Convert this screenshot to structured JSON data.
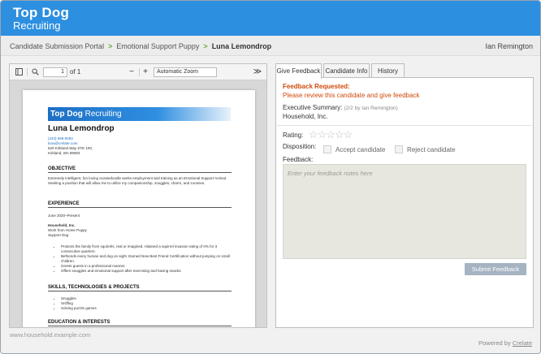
{
  "brand": {
    "title": "Top Dog",
    "subtitle": "Recruiting"
  },
  "breadcrumb": {
    "items": [
      "Candidate Submission Portal",
      "Emotional Support Puppy",
      "Luna Lemondrop"
    ],
    "separator": ">"
  },
  "user": {
    "name": "Ian Remington"
  },
  "viewer": {
    "page_current": "1",
    "page_total_label": "of 1",
    "zoom": "Automatic Zoom",
    "icons": [
      "sidebar-toggle-icon",
      "search-icon",
      "zoom-out-icon",
      "zoom-in-icon",
      "more-tools-icon"
    ],
    "zoom_out": "−",
    "zoom_in": "+",
    "more": "≫"
  },
  "resume": {
    "banner_bold": "Top Dog",
    "banner_light": "Recruiting",
    "name": "Luna Lemondrop",
    "phone": "(443) 568-9283",
    "email": "luna@crelate.com",
    "address1": "620 Kirkland Way STE 100,",
    "address2": "Kirkland, WA 98083",
    "objective_heading": "OBJECTIVE",
    "objective_text": "Extremely intelligent, fun loving Aussiedoodle seeks employment and training as an Emotional Support Animal. Seeking a position that will allow me to utilize my companionship, snuggles, charm, and zoomies.",
    "experience_heading": "EXPERIENCE",
    "exp_dates": "June 2020–Present",
    "exp_company": "Household, Inc.",
    "exp_location": "Work from Home Puppy",
    "exp_title": "Support Dog",
    "exp_bullets": [
      "Protects the family from squirrels, real or imagined. Attained a squirrel invasion rating of 0% for 3 consecutive quarters.",
      "Befriends every human and dog on sight. Earned New Best Friend Certification without jumping on small children.",
      "Greets guests in a professional manner.",
      "Offers snuggles and emotional support after exercising and having snacks."
    ],
    "skills_heading": "SKILLS, TECHNOLOGIES & PROJECTS",
    "skills": [
      "Snuggles",
      "Sniffing",
      "Solving puzzle games"
    ],
    "education_heading": "EDUCATION & INTERESTS"
  },
  "tabs": [
    {
      "label": "Give Feedback",
      "active": true
    },
    {
      "label": "Candidate Info",
      "active": false
    },
    {
      "label": "History",
      "active": false
    }
  ],
  "feedback": {
    "requested_title": "Feedback Requested:",
    "requested_msg": "Please review this candidate and give feedback",
    "exec_label": "Executive Summary:",
    "exec_meta": "(2/2 by Ian Remington)",
    "exec_value": "Household, Inc.",
    "rating_label": "Rating:",
    "rating_value": 0,
    "rating_max": 5,
    "stars": "☆☆☆☆☆",
    "disposition_label": "Disposition:",
    "accept_label": "Accept candidate",
    "reject_label": "Reject candidate",
    "feedback_label": "Feedback:",
    "feedback_placeholder": "Enter your feedback notes here",
    "feedback_value": "",
    "submit_label": "Submit Feedback"
  },
  "footer": {
    "url": "www.household.example.com",
    "powered_prefix": "Powered by",
    "powered_link": "Crelate"
  },
  "colors": {
    "brand_blue": "#2d8fe0",
    "breadcrumb_separator": "#6aaa3a",
    "alert_orange": "#d04a0b",
    "submit_disabled": "#a5b3c2"
  }
}
